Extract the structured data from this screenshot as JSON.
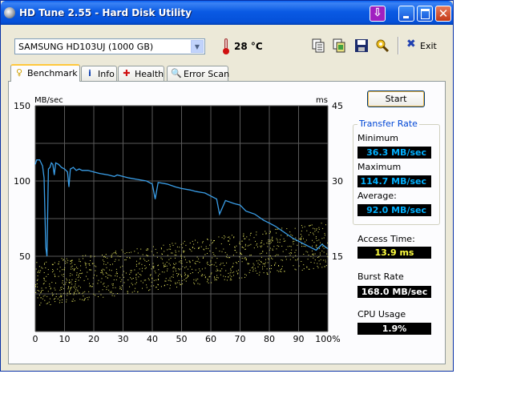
{
  "window": {
    "title": "HD Tune 2.55 - Hard Disk Utility"
  },
  "toolbar": {
    "drive": "SAMSUNG HD103UJ (1000 GB)",
    "temperature": "28 °C",
    "exit_label": "Exit",
    "icons": [
      "copy-text-icon",
      "copy-screenshot-icon",
      "save-icon",
      "options-icon",
      "exit-icon"
    ]
  },
  "tabs": [
    {
      "label": "Benchmark",
      "icon": "benchmark-icon",
      "active": true
    },
    {
      "label": "Info",
      "icon": "info-icon",
      "active": false
    },
    {
      "label": "Health",
      "icon": "health-icon",
      "active": false
    },
    {
      "label": "Error Scan",
      "icon": "error-scan-icon",
      "active": false
    }
  ],
  "buttons": {
    "start": "Start"
  },
  "transfer_rate": {
    "title": "Transfer Rate",
    "minimum_label": "Minimum",
    "minimum": "36.3 MB/sec",
    "maximum_label": "Maximum",
    "maximum": "114.7 MB/sec",
    "average_label": "Average:",
    "average": "92.0 MB/sec"
  },
  "access_time": {
    "label": "Access Time:",
    "value": "13.9 ms"
  },
  "burst_rate": {
    "label": "Burst Rate",
    "value": "168.0 MB/sec"
  },
  "cpu_usage": {
    "label": "CPU Usage",
    "value": "1.9%"
  },
  "colors": {
    "transfer_line": "#3a9ee8",
    "access_points": "#e8e860",
    "chart_bg": "#000000",
    "grid": "#5a5a5a"
  },
  "chart_data": {
    "type": "line",
    "ylabel_left": "MB/sec",
    "ylabel_right": "ms",
    "ylim_left": [
      0,
      150
    ],
    "ylim_right": [
      0,
      45
    ],
    "xlim": [
      0,
      100
    ],
    "left_ticks": [
      "150",
      "100",
      "50"
    ],
    "left_tick_values": [
      150,
      100,
      50
    ],
    "right_ticks": [
      "45",
      "30",
      "15"
    ],
    "right_tick_values": [
      45,
      30,
      15
    ],
    "x_ticks": [
      "0",
      "10",
      "20",
      "30",
      "40",
      "50",
      "60",
      "70",
      "80",
      "90",
      "100%"
    ],
    "x_tick_values": [
      0,
      10,
      20,
      30,
      40,
      50,
      60,
      70,
      80,
      90,
      100
    ],
    "grid": true,
    "transfer_rate": {
      "x": [
        0,
        0.5,
        1.5,
        2,
        2.5,
        3,
        3.3,
        3.6,
        4,
        4.5,
        5,
        5.5,
        6,
        6.5,
        7,
        8,
        9,
        10,
        11,
        11.5,
        12,
        13,
        14,
        15,
        16,
        18,
        20,
        22,
        25,
        27,
        28,
        30,
        32,
        35,
        38,
        40,
        41,
        42,
        45,
        48,
        50,
        53,
        55,
        58,
        60,
        62,
        63,
        65,
        68,
        70,
        72,
        75,
        78,
        80,
        82,
        85,
        88,
        90,
        92,
        94,
        96,
        98,
        100
      ],
      "y": [
        111,
        114,
        114,
        112,
        110,
        102,
        80,
        56,
        50,
        108,
        109,
        112,
        111,
        104,
        112,
        111,
        109,
        108,
        106,
        96,
        108,
        109,
        107,
        108,
        107,
        107,
        106,
        105,
        104,
        103,
        104,
        103,
        102,
        101,
        100,
        98,
        88,
        99,
        98,
        96,
        95,
        94,
        93,
        92,
        90,
        88,
        78,
        87,
        85,
        84,
        80,
        78,
        74,
        72,
        70,
        66,
        62,
        60,
        58,
        56,
        54,
        58,
        55
      ]
    },
    "access_time_scatter": {
      "unit": "ms",
      "range": [
        6,
        24
      ],
      "trend": "rising from ~9 ms at 0% to ~17 ms at 100%"
    }
  }
}
